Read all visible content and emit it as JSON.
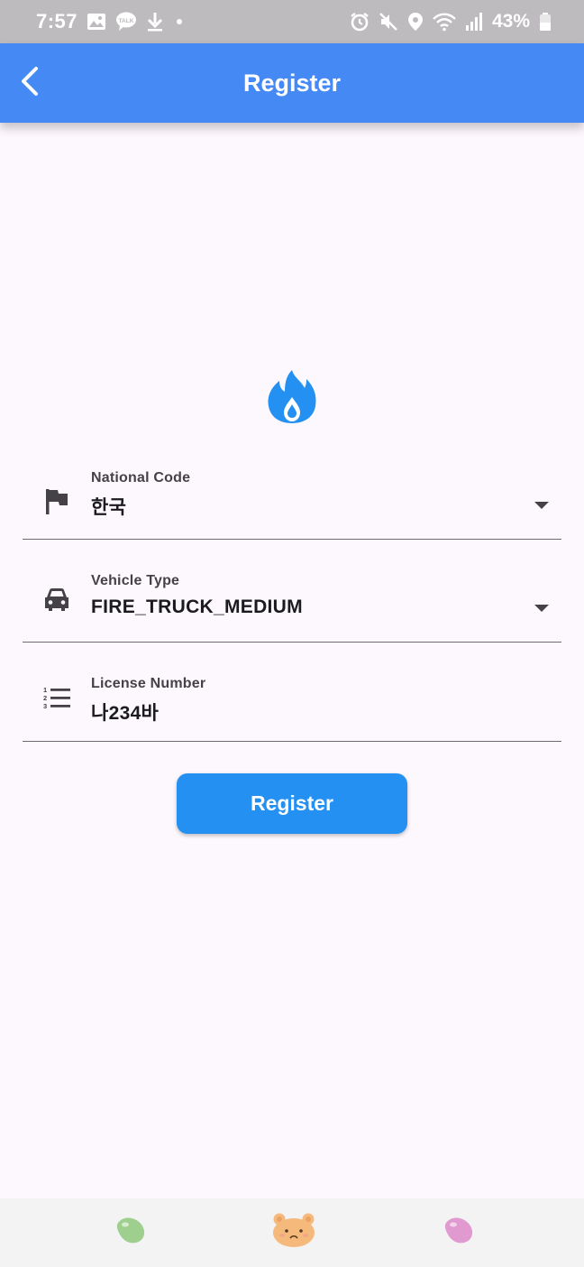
{
  "status_bar": {
    "time": "7:57",
    "battery": "43%",
    "left_icons": [
      "gallery-icon",
      "talk-icon",
      "download-icon",
      "dot-icon"
    ],
    "right_icons": [
      "alarm-icon",
      "mute-icon",
      "location-icon",
      "wifi-icon",
      "signal-icon",
      "battery-icon"
    ],
    "talk_badge": "TALK"
  },
  "app_bar": {
    "title": "Register",
    "back_icon": "chevron-left-icon",
    "color": "#4589f5"
  },
  "logo": {
    "icon": "flame-drop-icon",
    "color": "#2390f2"
  },
  "form": {
    "national_code": {
      "label": "National Code",
      "value": "한국",
      "icon": "flag-icon"
    },
    "vehicle_type": {
      "label": "Vehicle Type",
      "value": "FIRE_TRUCK_MEDIUM",
      "icon": "car-icon"
    },
    "license_number": {
      "label": "License Number",
      "value": "나234바",
      "icon": "numbered-list-icon"
    }
  },
  "register_button": {
    "label": "Register",
    "color": "#2390f2"
  },
  "bottom_bar": {
    "items": [
      {
        "icon": "green-jellybean-icon",
        "color": "#9fcf8e"
      },
      {
        "icon": "bear-face-icon",
        "color": "#f5b97c"
      },
      {
        "icon": "pink-jellybean-icon",
        "color": "#e09ad0"
      }
    ]
  }
}
